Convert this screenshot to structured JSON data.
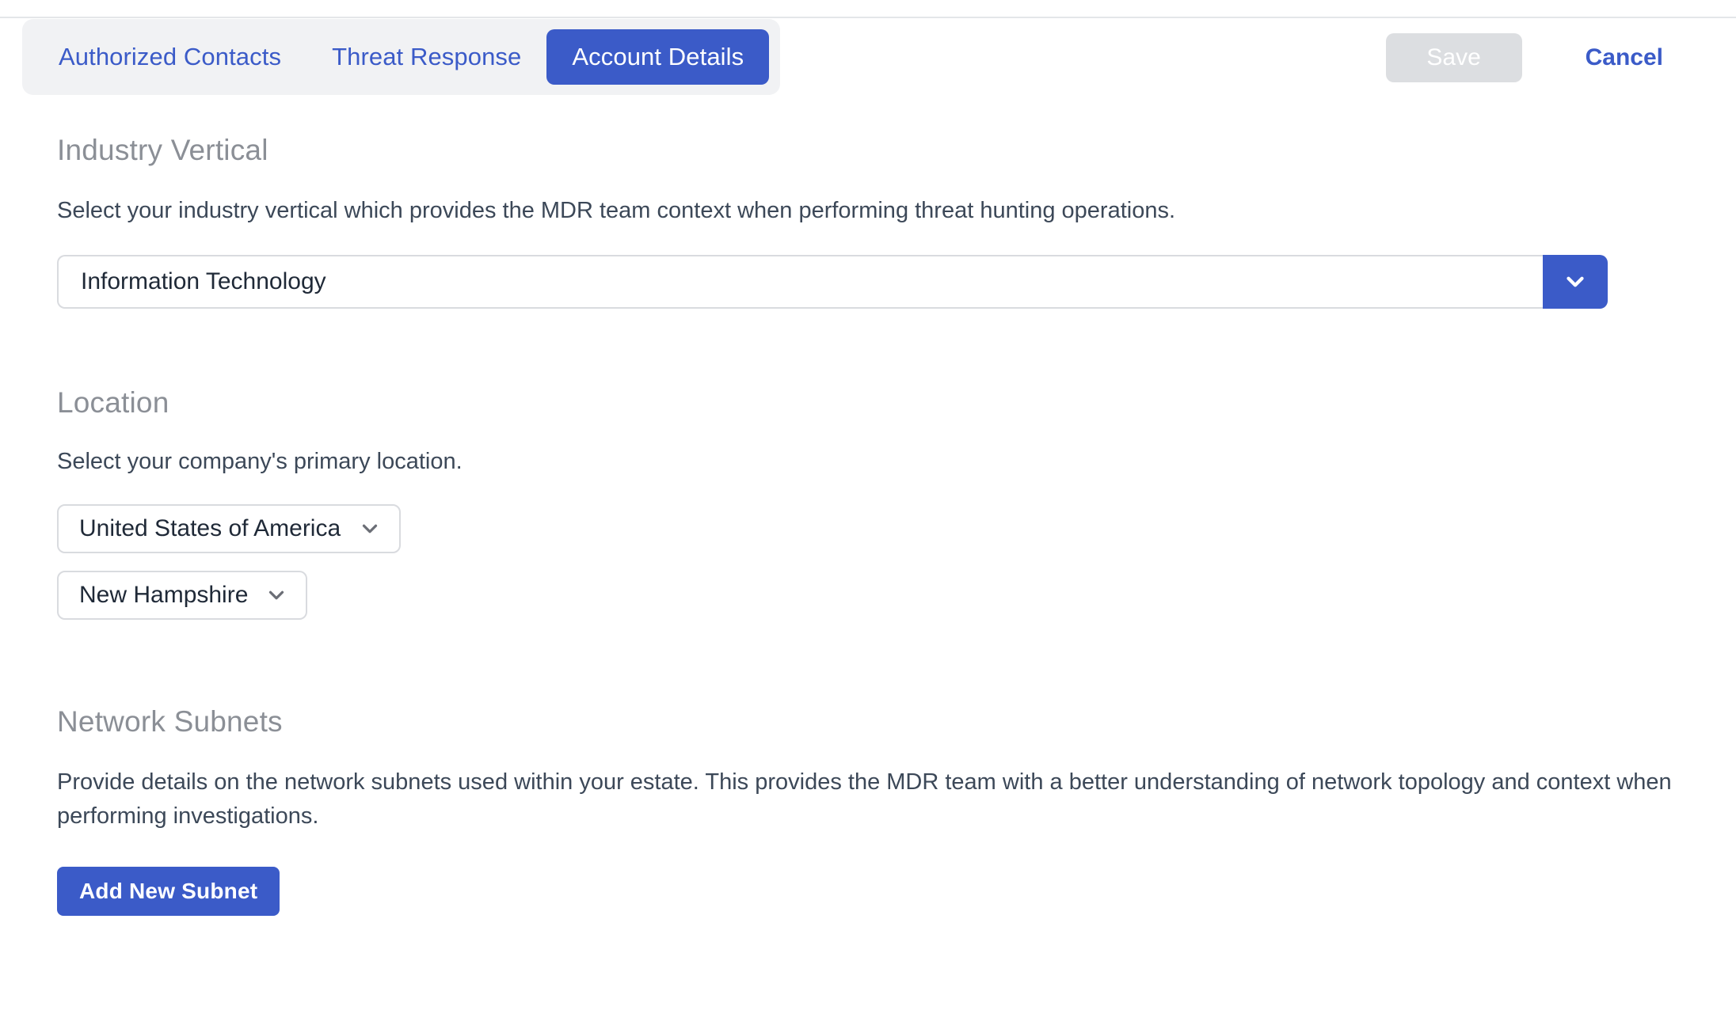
{
  "header": {
    "tabs": [
      {
        "label": "Authorized Contacts",
        "active": false
      },
      {
        "label": "Threat Response",
        "active": false
      },
      {
        "label": "Account Details",
        "active": true
      }
    ],
    "save_label": "Save",
    "cancel_label": "Cancel",
    "save_disabled": true
  },
  "colors": {
    "accent": "#3b5bc8",
    "tabgroup_bg": "#f1f2f4",
    "save_disabled_bg": "#dcdee1",
    "heading": "#8b8f96",
    "body_text": "#3c4858",
    "border": "#d9dbdf",
    "chevron_gray": "#6b6e76",
    "rule": "#e4e6e9"
  },
  "sections": {
    "industry": {
      "title": "Industry Vertical",
      "description": "Select your industry vertical which provides the MDR team context when performing threat hunting operations.",
      "field": {
        "value": "Information Technology",
        "placeholder": "Information Technology",
        "dropdown_icon": "chevron-down-icon"
      }
    },
    "location": {
      "title": "Location",
      "description": "Select your company's primary location.",
      "country": {
        "value": "United States of America",
        "options": [
          "United States of America"
        ],
        "dropdown_icon": "chevron-down-icon"
      },
      "state": {
        "value": "New Hampshire",
        "options": [
          "New Hampshire"
        ],
        "dropdown_icon": "chevron-down-icon"
      }
    },
    "subnets": {
      "title": "Network Subnets",
      "description": "Provide details on the network subnets used within your estate. This provides the MDR team with a better understanding of network topology and context when performing investigations.",
      "add_button_label": "Add New Subnet"
    }
  }
}
